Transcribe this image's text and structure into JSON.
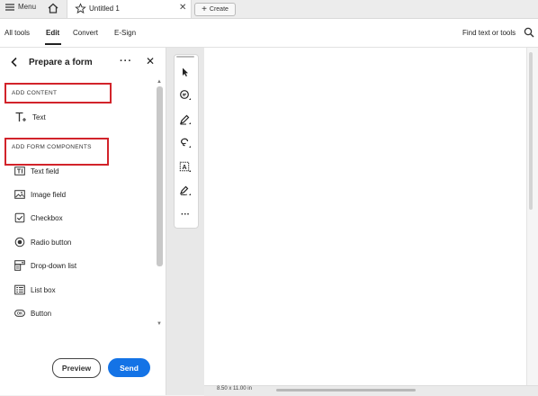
{
  "tabbar": {
    "menu_label": "Menu",
    "doc_tab_title": "Untitled 1",
    "create_label": "Create"
  },
  "toolbar": {
    "items": [
      "All tools",
      "Edit",
      "Convert",
      "E-Sign"
    ],
    "active": "Edit",
    "find_label": "Find text or tools"
  },
  "panel": {
    "title": "Prepare a form",
    "sections": {
      "content": {
        "header": "ADD CONTENT",
        "items": [
          {
            "label": "Text",
            "icon": "text-add-icon"
          }
        ]
      },
      "form": {
        "header": "ADD FORM COMPONENTS",
        "items": [
          {
            "label": "Text field",
            "icon": "text-field-icon"
          },
          {
            "label": "Image field",
            "icon": "image-field-icon"
          },
          {
            "label": "Checkbox",
            "icon": "checkbox-icon"
          },
          {
            "label": "Radio button",
            "icon": "radio-button-icon"
          },
          {
            "label": "Drop-down list",
            "icon": "dropdown-list-icon"
          },
          {
            "label": "List box",
            "icon": "list-box-icon"
          },
          {
            "label": "Button",
            "icon": "button-ok-icon"
          }
        ]
      }
    },
    "highlight_color": "#d2232a",
    "preview_label": "Preview",
    "send_label": "Send",
    "send_color": "#1473e6"
  },
  "canvas": {
    "tools": [
      "select-icon",
      "comment-icon",
      "highlight-pen-icon",
      "lasso-icon",
      "text-select-icon",
      "draw-icon",
      "more-tools-icon"
    ],
    "page_size": "8.50 x 11.00 in"
  }
}
